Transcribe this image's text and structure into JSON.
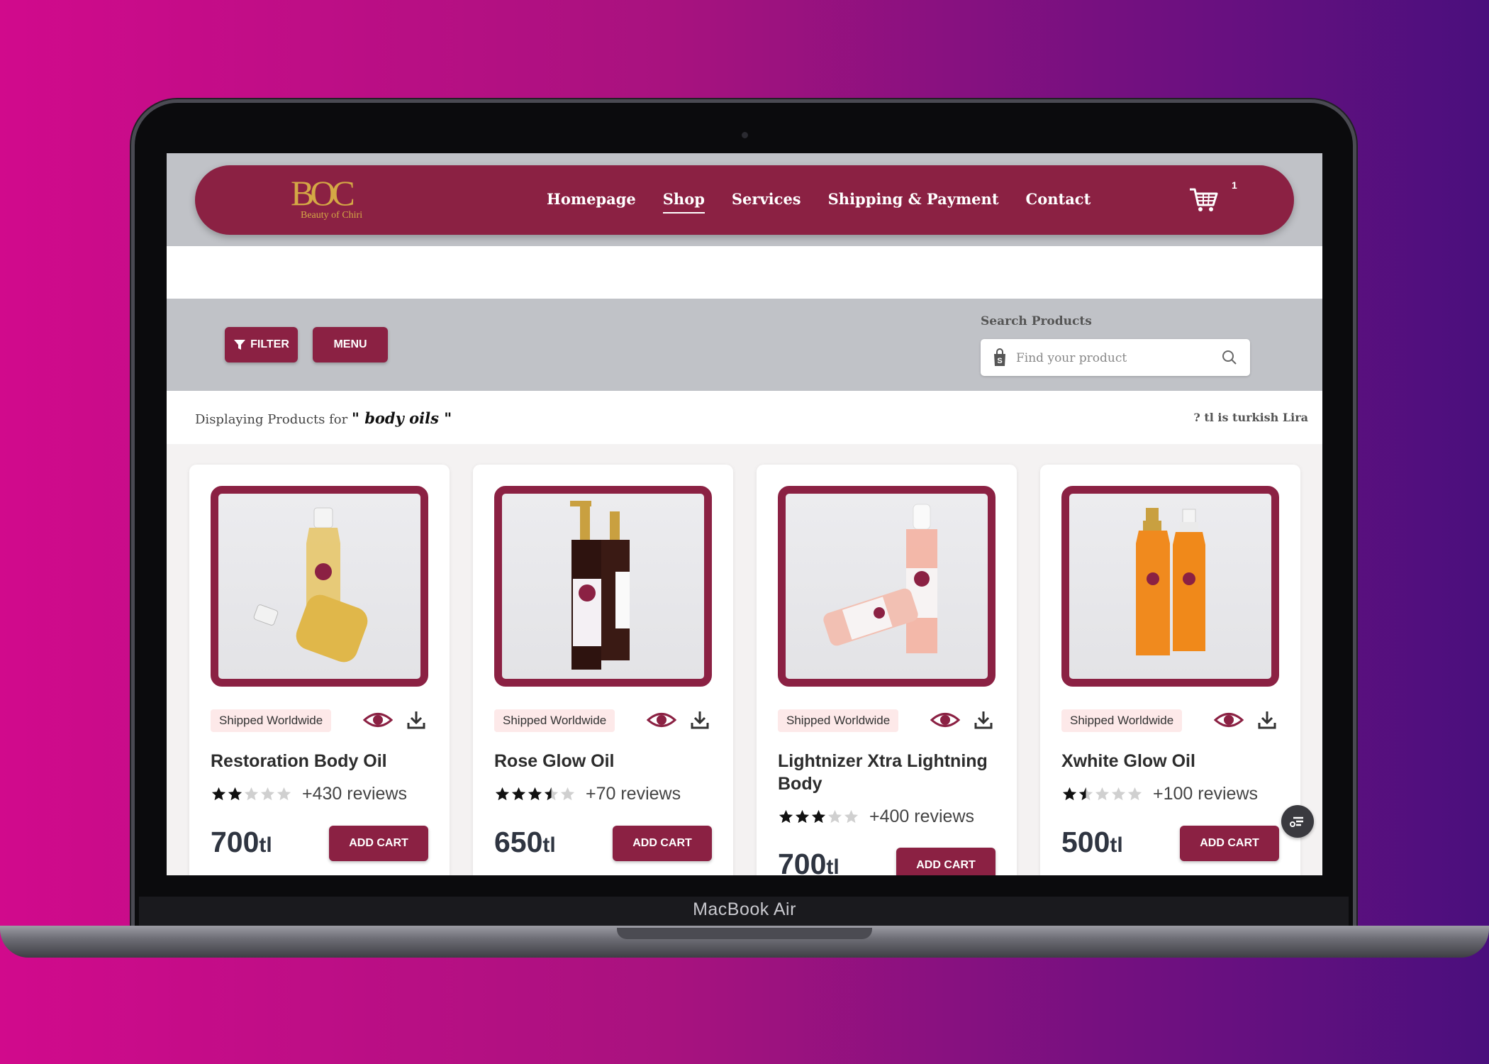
{
  "device": {
    "label": "MacBook Air"
  },
  "brand": {
    "logo_mark": "BOC",
    "logo_sub": "Beauty of Chiri",
    "primary_color": "#8b2143",
    "gold_color": "#d4a845"
  },
  "nav": {
    "links": [
      {
        "label": "Homepage",
        "active": false
      },
      {
        "label": "Shop",
        "active": true
      },
      {
        "label": "Services",
        "active": false
      },
      {
        "label": "Shipping & Payment",
        "active": false
      },
      {
        "label": "Contact",
        "active": false
      }
    ],
    "cart_count": "1",
    "cart_icon": "cart-icon"
  },
  "toolbar": {
    "filter_label": "FILTER",
    "menu_label": "MENU",
    "search_label": "Search Products",
    "search_placeholder": "Find your product"
  },
  "results": {
    "prefix": "Displaying Products for ",
    "query": "\" body oils \"",
    "currency_note": "? tl is turkish Lira"
  },
  "products": [
    {
      "name": "Restoration Body Oil",
      "badge": "Shipped Worldwide",
      "rating": 2,
      "reviews": "+430 reviews",
      "price": "700",
      "unit": "tl",
      "cta": "ADD CART",
      "bottle_color": "#e0b74a"
    },
    {
      "name": "Rose Glow Oil",
      "badge": "Shipped Worldwide",
      "rating": 3.5,
      "reviews": "+70 reviews",
      "price": "650",
      "unit": "tl",
      "cta": "ADD CART",
      "bottle_color": "#3a1a14"
    },
    {
      "name": "Lightnizer Xtra Lightning Body",
      "badge": "Shipped Worldwide",
      "rating": 3,
      "reviews": "+400 reviews",
      "price": "700",
      "unit": "tl",
      "cta": "ADD CART",
      "bottle_color": "#f4b2a2"
    },
    {
      "name": "Xwhite Glow Oil",
      "badge": "Shipped Worldwide",
      "rating": 1.5,
      "reviews": "+100 reviews",
      "price": "500",
      "unit": "tl",
      "cta": "ADD CART",
      "bottle_color": "#f08a1e"
    }
  ]
}
